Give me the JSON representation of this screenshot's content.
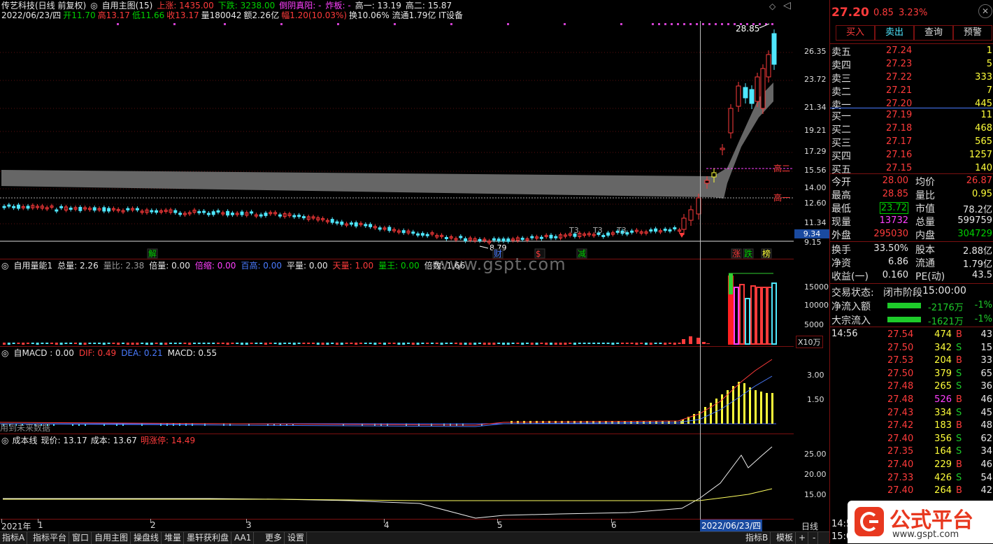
{
  "main_chart": {
    "line1": [
      {
        "t": "传艺科技(日线 前复权)",
        "c": "wht"
      },
      {
        "t": "◎",
        "c": "wht"
      },
      {
        "t": "自用主图(15)",
        "c": "wht"
      },
      {
        "t": "上涨: 1435.00",
        "c": "red"
      },
      {
        "t": "下跌: 3238.00",
        "c": "grn"
      },
      {
        "t": "倒阴真阳: -",
        "c": "mag"
      },
      {
        "t": "炸板: -",
        "c": "mag"
      },
      {
        "t": "高一: 13.19",
        "c": "wht"
      },
      {
        "t": "高二: 15.87",
        "c": "wht"
      }
    ],
    "line2": [
      {
        "t": "2022/06/23/四",
        "c": "wht"
      },
      {
        "t": "开11.70",
        "c": "grn"
      },
      {
        "t": "高13.17",
        "c": "red"
      },
      {
        "t": "低11.66",
        "c": "grn"
      },
      {
        "t": "收13.17",
        "c": "red"
      },
      {
        "t": "量180042",
        "c": "wht"
      },
      {
        "t": "额2.26亿",
        "c": "wht"
      },
      {
        "t": "幅1.20(10.03%)",
        "c": "red"
      },
      {
        "t": "换10.06% 流通1.79亿 IT设备",
        "c": "wht"
      }
    ],
    "price_scale": [
      "26.35",
      "23.72",
      "21.34",
      "19.21",
      "17.29",
      "15.56",
      "14.00",
      "12.60",
      "11.34",
      "9.34",
      "9.15"
    ],
    "last_price_box": "9.34",
    "peak_label": "28.85",
    "low_label": "8.79",
    "gao_labels": [
      "高二",
      "高一"
    ],
    "event_markers": [
      {
        "t": "解",
        "c": "grn"
      },
      {
        "t": "财",
        "c": "blue"
      },
      {
        "t": "$",
        "c": "red"
      },
      {
        "t": "减",
        "c": "grn"
      },
      {
        "t": "涨",
        "c": "red"
      },
      {
        "t": "跌",
        "c": "grn"
      },
      {
        "t": "榜",
        "c": "yel"
      }
    ],
    "t3_labels": [
      "T3",
      "T3",
      "T3"
    ],
    "watermark": "www.gspt.com"
  },
  "volume_panel": {
    "header": [
      {
        "t": "◎",
        "c": "wht"
      },
      {
        "t": "自用量能1",
        "c": "wht"
      },
      {
        "t": "总量: 2.26",
        "c": "wht"
      },
      {
        "t": "量比: 2.38",
        "c": "gray"
      },
      {
        "t": "倍量: 0.00",
        "c": "wht"
      },
      {
        "t": "倍缩: 0.00",
        "c": "mag"
      },
      {
        "t": "百高: 0.00",
        "c": "blue"
      },
      {
        "t": "平量: 0.00",
        "c": "wht"
      },
      {
        "t": "天量: 1.00",
        "c": "red"
      },
      {
        "t": "量王: 0.00",
        "c": "grn"
      },
      {
        "t": "倍数: 1.66",
        "c": "wht"
      }
    ],
    "scale": [
      "15000",
      "10000",
      "5000"
    ],
    "unit": "X10万"
  },
  "macd_panel": {
    "header": [
      {
        "t": "◎",
        "c": "wht"
      },
      {
        "t": "自MACD : 0.00",
        "c": "wht"
      },
      {
        "t": "DIF: 0.49",
        "c": "red"
      },
      {
        "t": "DEA: 0.21",
        "c": "blue"
      },
      {
        "t": "MACD: 0.55",
        "c": "wht"
      }
    ],
    "scale": [
      "3.00",
      "1.50"
    ],
    "note": "用到未来数据"
  },
  "cost_panel": {
    "header": [
      {
        "t": "◎",
        "c": "wht"
      },
      {
        "t": "成本线",
        "c": "wht"
      },
      {
        "t": "现价: 13.17",
        "c": "wht"
      },
      {
        "t": "成本: 13.67",
        "c": "wht"
      },
      {
        "t": "明涨停: 14.49",
        "c": "red"
      }
    ],
    "scale": [
      "25.00",
      "20.00",
      "15.00"
    ]
  },
  "time_axis": {
    "labels": [
      "2021年",
      "1",
      "2",
      "3",
      "4",
      "5",
      "6"
    ],
    "cursor_date": "2022/06/23/四",
    "period": "日线"
  },
  "status_tabs": [
    "指标A",
    "指标平台",
    "窗口",
    "自用主图",
    "操盘线",
    "堆量",
    "墨轩获利盘",
    "AA1",
    "更多",
    "设置"
  ],
  "status_right": [
    "指标B",
    "模板",
    "+",
    "-"
  ],
  "quote": {
    "price": "27.20",
    "change": "0.85",
    "pct": "3.23%",
    "buttons": [
      "买入",
      "卖出",
      "查询",
      "预警"
    ],
    "asks": [
      {
        "label": "卖五",
        "price": "27.24",
        "vol": "1"
      },
      {
        "label": "卖四",
        "price": "27.23",
        "vol": "5"
      },
      {
        "label": "卖三",
        "price": "27.22",
        "vol": "333"
      },
      {
        "label": "卖二",
        "price": "27.21",
        "vol": "7"
      },
      {
        "label": "卖一",
        "price": "27.20",
        "vol": "445"
      }
    ],
    "bids": [
      {
        "label": "买一",
        "price": "27.19",
        "vol": "11"
      },
      {
        "label": "买二",
        "price": "27.18",
        "vol": "468"
      },
      {
        "label": "买三",
        "price": "27.17",
        "vol": "565"
      },
      {
        "label": "买四",
        "price": "27.16",
        "vol": "1257"
      },
      {
        "label": "买五",
        "price": "27.15",
        "vol": "140"
      }
    ],
    "stats": [
      {
        "l1": "今开",
        "v1": "28.00",
        "c1": "red",
        "l2": "均价",
        "v2": "26.87",
        "c2": "red"
      },
      {
        "l1": "最高",
        "v1": "28.85",
        "c1": "red",
        "l2": "量比",
        "v2": "0.95",
        "c2": "yel"
      },
      {
        "l1": "最低",
        "v1": "23.72",
        "c1": "grn",
        "l2": "市值",
        "v2": "78.2亿",
        "c2": "wht"
      },
      {
        "l1": "现量",
        "v1": "13732",
        "c1": "mag",
        "l2": "总量",
        "v2": "599759",
        "c2": "wht"
      },
      {
        "l1": "外盘",
        "v1": "295030",
        "c1": "red",
        "l2": "内盘",
        "v2": "304729",
        "c2": "grn"
      }
    ],
    "stats2": [
      {
        "l1": "换手",
        "v1": "33.50%",
        "l2": "股本",
        "v2": "2.88亿"
      },
      {
        "l1": "净资",
        "v1": "6.86",
        "l2": "流通",
        "v2": "1.79亿"
      },
      {
        "l1": "收益(一)",
        "v1": "0.160",
        "l2": "PE(动)",
        "v2": "43.5"
      }
    ],
    "trade_state_label": "交易状态:",
    "trade_state": "闭市阶段",
    "trade_time": "15:00:00",
    "flows": [
      {
        "label": "净流入额",
        "value": "-2176万",
        "pct": "-1%"
      },
      {
        "label": "大宗流入",
        "value": "-1621万",
        "pct": "-1%"
      }
    ],
    "tick_time": "14:56",
    "ticks": [
      {
        "p": "27.54",
        "v": "474",
        "s": "B",
        "n": "43"
      },
      {
        "p": "27.50",
        "v": "342",
        "s": "S",
        "n": "15"
      },
      {
        "p": "27.53",
        "v": "204",
        "s": "B",
        "n": "33"
      },
      {
        "p": "27.50",
        "v": "379",
        "s": "S",
        "n": "65"
      },
      {
        "p": "27.48",
        "v": "265",
        "s": "S",
        "n": "36"
      },
      {
        "p": "27.48",
        "v": "526",
        "s": "B",
        "n": "46"
      },
      {
        "p": "27.43",
        "v": "334",
        "s": "S",
        "n": "45"
      },
      {
        "p": "27.42",
        "v": "183",
        "s": "B",
        "n": "48"
      },
      {
        "p": "27.40",
        "v": "356",
        "s": "S",
        "n": "62"
      },
      {
        "p": "27.35",
        "v": "164",
        "s": "S",
        "n": "34"
      },
      {
        "p": "27.40",
        "v": "229",
        "s": "B",
        "n": "46"
      },
      {
        "p": "27.33",
        "v": "426",
        "s": "S",
        "n": "54"
      },
      {
        "p": "27.40",
        "v": "264",
        "s": "B",
        "n": "42"
      }
    ],
    "bottom_times": [
      "14:5",
      "15:0"
    ]
  },
  "brand": {
    "name": "公式平台",
    "url": "www.gspt.com",
    "color": "#e8381f"
  }
}
